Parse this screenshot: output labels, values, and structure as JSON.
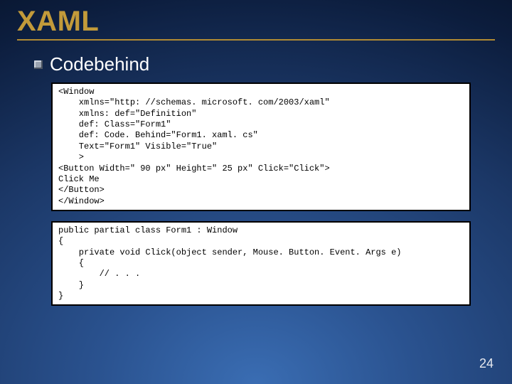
{
  "title": "XAML",
  "bullet": "Codebehind",
  "code1": "<Window\n    xmlns=\"http: //schemas. microsoft. com/2003/xaml\"\n    xmlns: def=\"Definition\"\n    def: Class=\"Form1\"\n    def: Code. Behind=\"Form1. xaml. cs\"\n    Text=\"Form1\" Visible=\"True\"\n    >\n<Button Width=\" 90 px\" Height=\" 25 px\" Click=\"Click\">\nClick Me\n</Button>\n</Window>",
  "code2": "public partial class Form1 : Window\n{\n    private void Click(object sender, Mouse. Button. Event. Args e)\n    {\n        // . . .\n    }\n}",
  "page": "24"
}
